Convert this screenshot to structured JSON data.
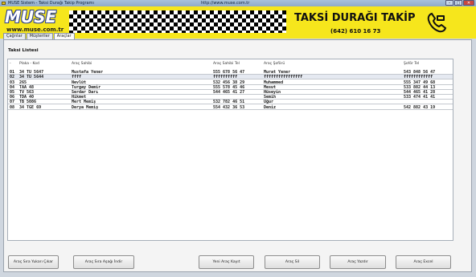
{
  "titlebar": {
    "title": "MUSE Sistem - Taksi Durağı Takip Programı",
    "url": "http://www.muse.com.tr"
  },
  "header": {
    "logo_text": "MUSE",
    "logo_url": "www.muse.com.tr",
    "app_title": "TAKSİ DURAĞI TAKİP",
    "phone": "(642) 610 16 73",
    "accent_color": "#f6e61c"
  },
  "tabs": [
    {
      "label": "Çağrılar"
    },
    {
      "label": "Müşteriler"
    },
    {
      "label": "Araçlar",
      "active": true
    }
  ],
  "panel": {
    "title": "Taksi Listesi"
  },
  "table": {
    "columns": [
      "-",
      "Plaka - Kod",
      "Araç Sahibi",
      "Araç Sahibi Tel",
      "Araç Şoförü",
      "Şoför Tel"
    ],
    "rows": [
      [
        "01",
        "34 TU 5647",
        "Mustafa Yener",
        "555 678 56 47",
        "Murat Yener",
        "543 848 56 47"
      ],
      [
        "02",
        "34 TU 5644",
        "ffff",
        "ffffffffff",
        "ffffffffffffffff",
        "ffffffffffff"
      ],
      [
        "03",
        "265",
        "Nevlüt",
        "532 456 38 29",
        "Muhammed",
        "555 347 49 68"
      ],
      [
        "04",
        "TAA 48",
        "Turgay Demir",
        "555 578 45 46",
        "Mesut",
        "533 882 44 13"
      ],
      [
        "05",
        "TV 563",
        "Serdar Darı",
        "544 465 41 27",
        "Hüseyin",
        "544 465 41 28"
      ],
      [
        "06",
        "TDA 40",
        "Hikmet",
        "",
        "Semih",
        "533 474 41 41"
      ],
      [
        "07",
        "TB 5086",
        "Mert Memiş",
        "532 782 46 51",
        "Uğur",
        ""
      ],
      [
        "08",
        "34 TGE 69",
        "Derya Memiş",
        "554 432 36 53",
        "Deniz",
        "542 882 43 19"
      ]
    ]
  },
  "buttons": {
    "move_up": "Araç Sıra Yukarı Çıkar",
    "move_down": "Araç Sıra Aşağı İndir",
    "new_vehicle": "Yeni Araç Kayıt",
    "delete_vehicle": "Araç Sil",
    "print_vehicle": "Araç Yazdır",
    "excel_vehicle": "Araç Excel"
  },
  "icons": {
    "phone": "phone-icon",
    "app": "taxi-app-icon"
  }
}
